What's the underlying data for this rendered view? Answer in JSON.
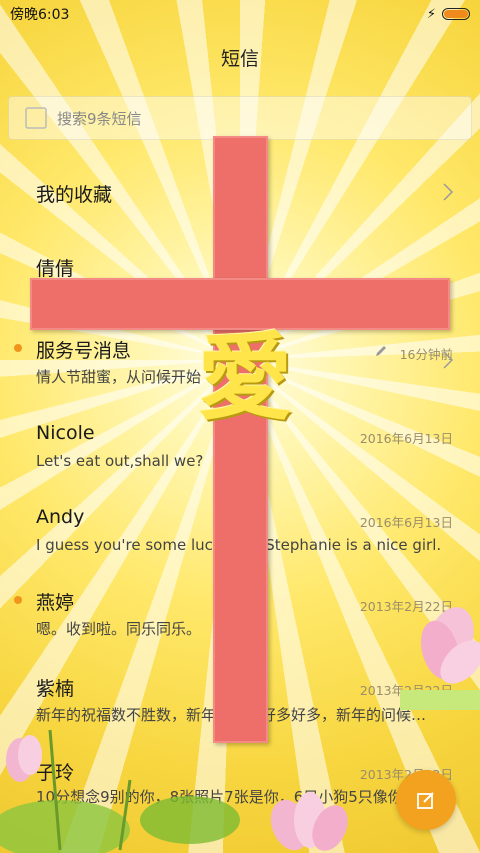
{
  "status_bar": {
    "time": "傍晚6:03"
  },
  "header": {
    "title": "短信"
  },
  "search": {
    "placeholder": "搜索9条短信"
  },
  "cross_text": "愛",
  "conversations": [
    {
      "name": "我的收藏",
      "preview": "",
      "time": "",
      "unread": false,
      "chevron": true
    },
    {
      "name": "倩倩",
      "preview": "a",
      "time": "16分钟前",
      "unread": false,
      "draft": true
    },
    {
      "name": "服务号消息",
      "preview": "情人节甜蜜，从问候开始",
      "time": "",
      "unread": true,
      "chevron": true
    },
    {
      "name": "Nicole",
      "preview": "Let's eat out,shall we?",
      "time": "2016年6月13日",
      "unread": false
    },
    {
      "name": "Andy",
      "preview": "I guess you're some lucky guy.Stephanie is a nice girl.",
      "time": "2016年6月13日",
      "unread": false
    },
    {
      "name": "燕婷",
      "preview": "嗯。收到啦。同乐同乐。",
      "time": "2013年2月22日",
      "unread": true
    },
    {
      "name": "紫楠",
      "preview": "新年的祝福数不胜数，新年的愿望好多好多，新年的问候…",
      "time": "2013年2月22日",
      "unread": false
    },
    {
      "name": "子玲",
      "preview": "10分想念9别的你，8张照片7张是你，6只小狗5只像你",
      "time": "2013年2月22日",
      "unread": false
    }
  ],
  "colors": {
    "accent": "#f3a21f",
    "cross": "#ee6f6a",
    "unread_dot": "#f0941c"
  },
  "icons": [
    "lightning-icon",
    "battery-icon",
    "search-icon",
    "chevron-right-icon",
    "pencil-icon",
    "compose-icon"
  ]
}
